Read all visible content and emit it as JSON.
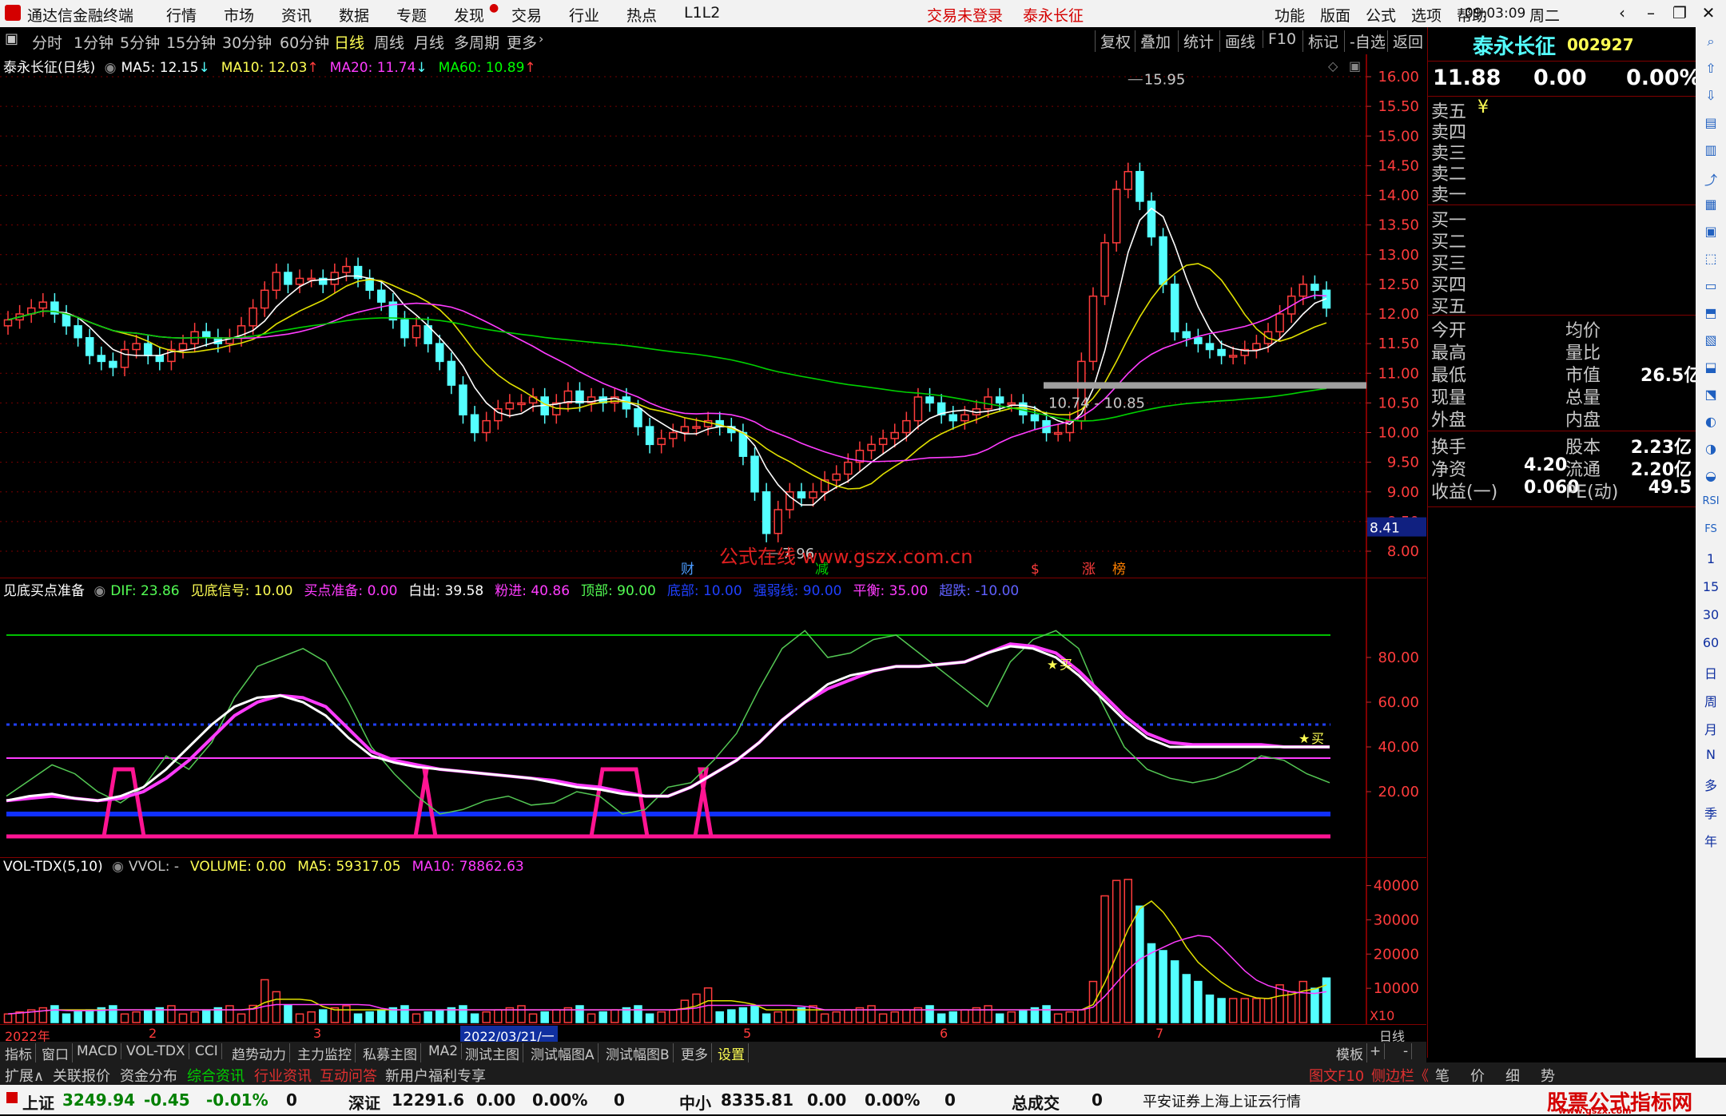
{
  "menubar": {
    "app_title": "通达信金融终端",
    "items": [
      "行情",
      "市场",
      "资讯",
      "数据",
      "专题",
      "发现",
      "交易",
      "行业",
      "热点",
      "L1L2"
    ],
    "notice": "交易未登录",
    "stock": "泰永长征",
    "right_items": [
      "功能",
      "版面",
      "公式",
      "选项",
      "帮助"
    ],
    "time": "09:03:09",
    "weekday": "周二"
  },
  "tabs": {
    "periods": [
      "分时",
      "1分钟",
      "5分钟",
      "15分钟",
      "30分钟",
      "60分钟",
      "日线",
      "周线",
      "月线",
      "多周期",
      "更多"
    ],
    "active": "日线",
    "right": [
      "复权",
      "叠加",
      "统计",
      "画线",
      "F10",
      "标记",
      "-自选",
      "返回"
    ]
  },
  "main_chart": {
    "title": "泰永长征(日线)",
    "ma": [
      {
        "label": "MA5: 12.15",
        "color": "#ffffff"
      },
      {
        "label": "MA10: 12.03",
        "color": "#ffff54"
      },
      {
        "label": "MA20: 11.74",
        "color": "#ff3cff"
      },
      {
        "label": "MA60: 10.89",
        "color": "#00ff00"
      }
    ],
    "y_ticks": [
      "16.00",
      "15.50",
      "15.00",
      "14.50",
      "14.00",
      "13.50",
      "13.00",
      "12.50",
      "12.00",
      "11.50",
      "11.00",
      "10.50",
      "10.00",
      "9.50",
      "9.00",
      "8.50",
      "8.00"
    ],
    "high_label": "15.95",
    "low_label": "7.96",
    "range_label": "10.74 - 10.85",
    "cursor_price": "8.41",
    "watermark": "公式在线 www.gszx.com.cn",
    "markers": [
      {
        "text": "财",
        "color": "#4c9cff"
      },
      {
        "text": "减",
        "color": "#00d000"
      },
      {
        "text": "$",
        "color": "#ff3c3c"
      },
      {
        "text": "涨",
        "color": "#ff3c3c"
      },
      {
        "text": "榜",
        "color": "#ff8000"
      }
    ]
  },
  "indicator": {
    "name": "见底买点准备",
    "fields": [
      {
        "label": "DIF: 23.86",
        "color": "#54ff54"
      },
      {
        "label": "见底信号: 10.00",
        "color": "#ffff54"
      },
      {
        "label": "买点准备: 0.00",
        "color": "#ff3cff"
      },
      {
        "label": "白出: 39.58",
        "color": "#ffffff"
      },
      {
        "label": "粉进: 40.86",
        "color": "#ff3cff"
      },
      {
        "label": "顶部: 90.00",
        "color": "#54ff54"
      },
      {
        "label": "底部: 10.00",
        "color": "#2040ff"
      },
      {
        "label": "强弱线: 90.00",
        "color": "#2040ff"
      },
      {
        "label": "平衡: 35.00",
        "color": "#ff3cff"
      },
      {
        "label": "超跌: -10.00",
        "color": "#6060ff"
      }
    ],
    "y_ticks": [
      "80.00",
      "60.00",
      "40.00",
      "20.00"
    ],
    "buy_label": "买"
  },
  "volume": {
    "name": "VOL-TDX(5,10)",
    "fields": [
      {
        "label": "VVOL: -",
        "color": "#c8c8c8"
      },
      {
        "label": "VOLUME: 0.00",
        "color": "#ffff54"
      },
      {
        "label": "MA5: 59317.05",
        "color": "#ffff54"
      },
      {
        "label": "MA10: 78862.63",
        "color": "#ff3cff"
      }
    ],
    "y_ticks": [
      "40000",
      "30000",
      "20000",
      "10000"
    ],
    "unit": "X10"
  },
  "xaxis": {
    "labels": [
      "2022年",
      "2",
      "3",
      "2022/03/21/一",
      "5",
      "6",
      "7"
    ],
    "period": "日线"
  },
  "bottom_tabs": [
    "指标",
    "窗口",
    "MACD",
    "VOL-TDX",
    "CCI",
    "趋势动力",
    "主力监控",
    "私募主图",
    "MA2",
    "测试主图",
    "测试幅图A",
    "测试幅图B",
    "更多",
    "设置"
  ],
  "bottom_right": [
    "模板",
    "+",
    "-"
  ],
  "bottom_tabs2": [
    "扩展∧",
    "关联报价",
    "资金分布",
    "综合资讯",
    "行业资讯",
    "互动问答",
    "新用户福利专享"
  ],
  "bottom_tabs2_right": [
    "图文F10",
    "侧边栏《",
    "笔",
    "价",
    "细",
    "势"
  ],
  "quote": {
    "name": "泰永长征",
    "code": "002927",
    "price": "11.88",
    "change": "0.00",
    "pct": "0.00%",
    "sell": [
      "卖五",
      "卖四",
      "卖三",
      "卖二",
      "卖一"
    ],
    "sell_currency": "¥",
    "buy": [
      "买一",
      "买二",
      "买三",
      "买四",
      "买五"
    ],
    "stats_left": [
      "今开",
      "最高",
      "最低",
      "现量",
      "外盘"
    ],
    "stats_mid": [
      "均价",
      "量比",
      "市值",
      "总量",
      "内盘"
    ],
    "market_value": "26.5亿",
    "fin": [
      {
        "l": "换手",
        "v": "",
        "m": "股本",
        "r": "2.23亿"
      },
      {
        "l": "净资",
        "v": "4.20",
        "m": "流通",
        "r": "2.20亿"
      },
      {
        "l": "收益(一)",
        "v": "0.060",
        "m": "PE(动)",
        "r": "49.5"
      }
    ]
  },
  "right_toolbar": [
    "RSI",
    "FS",
    "1",
    "15",
    "30",
    "60",
    "日",
    "周",
    "月",
    "N",
    "多",
    "季",
    "年"
  ],
  "status": {
    "sh_name": "上证",
    "sh_val": "3249.94",
    "sh_chg": "-0.45",
    "sh_pct": "-0.01%",
    "sh_vol": "0",
    "sz_name": "深证",
    "sz_val": "12291.6",
    "sz_chg": "0.00",
    "sz_pct": "0.00%",
    "sz_vol": "0",
    "zx_name": "中小",
    "zx_val": "8335.81",
    "zx_chg": "0.00",
    "zx_pct": "0.00%",
    "zx_vol": "0",
    "total_label": "总成交",
    "total_val": "0",
    "broker": "平安证券上海上证云行情",
    "brand": "股票公式指标网",
    "brand_url": "www.gszx.com"
  },
  "chart_data": {
    "type": "candlestick",
    "price_axis": [
      8.0,
      16.0
    ],
    "closes": [
      11.9,
      12.0,
      12.1,
      12.2,
      12.0,
      11.8,
      11.6,
      11.3,
      11.2,
      11.1,
      11.4,
      11.5,
      11.3,
      11.2,
      11.4,
      11.5,
      11.7,
      11.6,
      11.5,
      11.6,
      11.8,
      12.1,
      12.4,
      12.7,
      12.5,
      12.6,
      12.6,
      12.5,
      12.7,
      12.8,
      12.6,
      12.4,
      12.2,
      11.9,
      11.6,
      11.8,
      11.5,
      11.2,
      10.8,
      10.3,
      10.0,
      10.2,
      10.4,
      10.5,
      10.5,
      10.6,
      10.3,
      10.5,
      10.7,
      10.5,
      10.6,
      10.5,
      10.6,
      10.4,
      10.1,
      9.8,
      9.9,
      10.0,
      10.1,
      10.1,
      10.2,
      10.1,
      10.0,
      9.6,
      9.0,
      8.3,
      8.7,
      9.0,
      8.9,
      9.0,
      9.2,
      9.3,
      9.5,
      9.7,
      9.8,
      9.9,
      10.0,
      10.2,
      10.6,
      10.5,
      10.3,
      10.2,
      10.3,
      10.4,
      10.6,
      10.5,
      10.5,
      10.3,
      10.2,
      10.0,
      10.0,
      10.2,
      11.2,
      12.3,
      13.2,
      14.1,
      14.4,
      13.9,
      13.3,
      12.5,
      11.7,
      11.6,
      11.5,
      11.4,
      11.3,
      11.3,
      11.4,
      11.5,
      11.7,
      12.0,
      12.3,
      12.5,
      12.4,
      12.1
    ]
  }
}
